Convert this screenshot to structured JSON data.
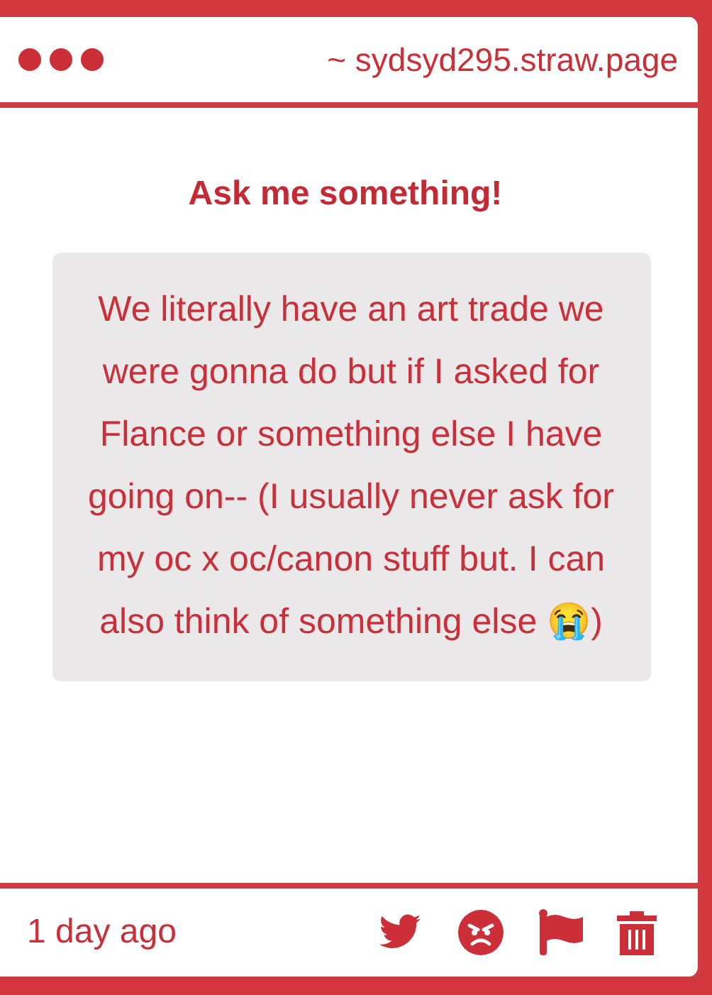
{
  "window": {
    "address": "~ sydsyd295.straw.page"
  },
  "title": "Ask me something!",
  "message": "We literally have an art trade we were gonna do but if I asked for Flance or something else I have going on-- (I usually never ask for my oc x oc/canon stuff but. I can also think of something else 😭)",
  "footer": {
    "time": "1 day ago"
  }
}
